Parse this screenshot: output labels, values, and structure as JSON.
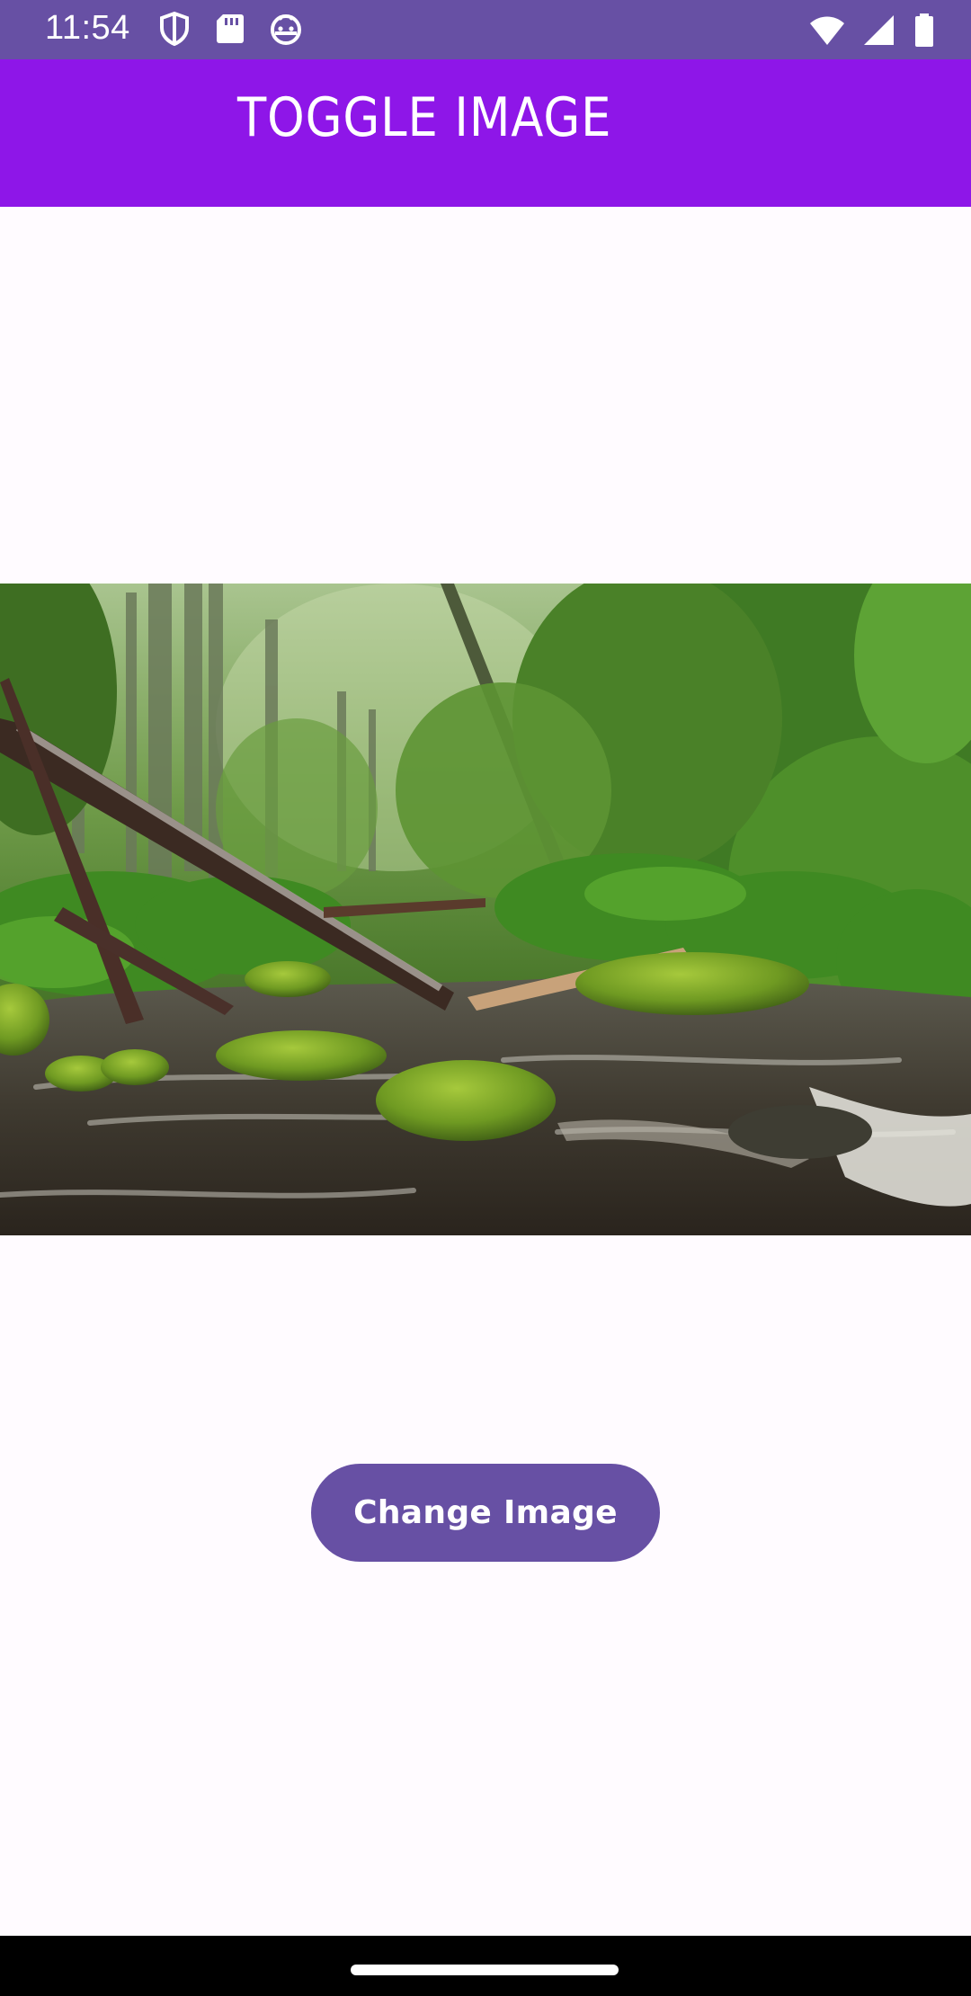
{
  "status_bar": {
    "time": "11:54",
    "icons_left": [
      "shield-icon",
      "sd-card-icon",
      "android-head-icon"
    ],
    "icons_right": [
      "wifi-icon",
      "signal-icon",
      "battery-icon"
    ],
    "background": "#6750a4"
  },
  "app_bar": {
    "title": "TOGGLE IMAGE",
    "background": "#8e16e8"
  },
  "main": {
    "image_icon": "forest-stream-photo",
    "change_button_label": "Change Image",
    "button_color": "#6750a4"
  },
  "navigation": {
    "handle_icon": "gesture-handle"
  }
}
